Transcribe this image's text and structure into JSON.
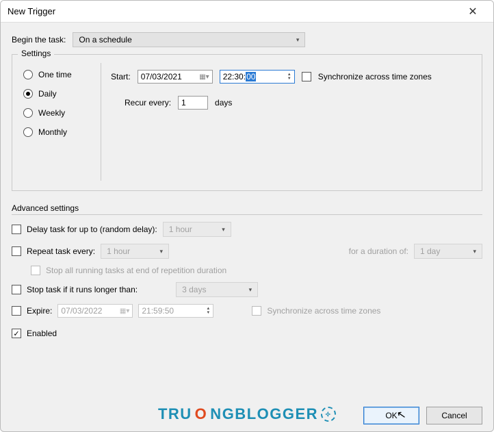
{
  "window": {
    "title": "New Trigger"
  },
  "begin": {
    "label": "Begin the task:",
    "value": "On a schedule"
  },
  "settings": {
    "legend": "Settings",
    "radios": {
      "onetime": "One time",
      "daily": "Daily",
      "weekly": "Weekly",
      "monthly": "Monthly"
    },
    "start_label": "Start:",
    "start_date": "07/03/2021",
    "start_time_prefix": "22:30:",
    "start_time_selected": "00",
    "sync_label": "Synchronize across time zones",
    "recur_label": "Recur every:",
    "recur_value": "1",
    "recur_unit": "days"
  },
  "advanced": {
    "legend": "Advanced settings",
    "delay_label": "Delay task for up to (random delay):",
    "delay_value": "1 hour",
    "repeat_label": "Repeat task every:",
    "repeat_value": "1 hour",
    "duration_label": "for a duration of:",
    "duration_value": "1 day",
    "stop_all_label": "Stop all running tasks at end of repetition duration",
    "stop_if_label": "Stop task if it runs longer than:",
    "stop_if_value": "3 days",
    "expire_label": "Expire:",
    "expire_date": "07/03/2022",
    "expire_time": "21:59:50",
    "expire_sync_label": "Synchronize across time zones",
    "enabled_label": "Enabled"
  },
  "footer": {
    "ok": "OK",
    "cancel": "Cancel"
  },
  "watermark": {
    "t1": "TRU",
    "o": "O",
    "t2": "NGBLOGGER"
  }
}
